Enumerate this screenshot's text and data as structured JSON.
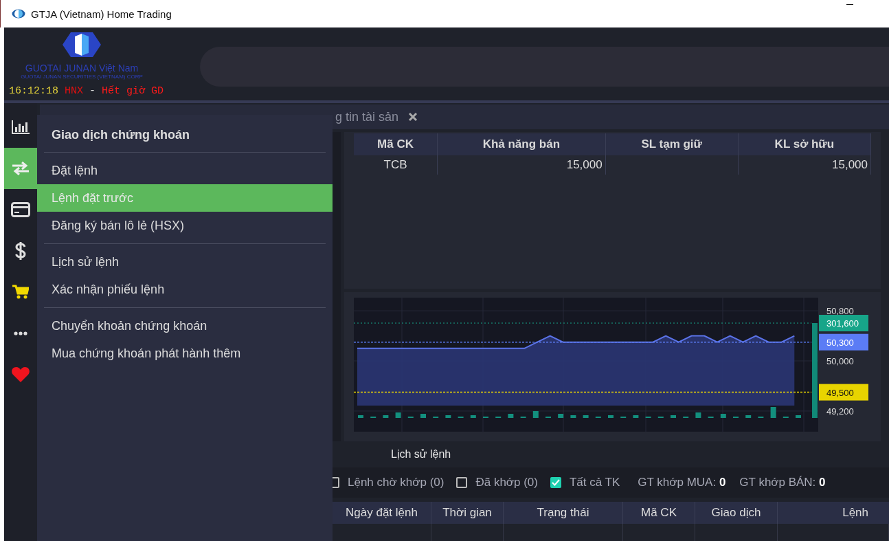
{
  "window": {
    "title": "GTJA (Vietnam) Home Trading"
  },
  "brand": {
    "name": "GUOTAI JUNAN Việt Nam",
    "subtitle": "GUOTAI JUNAN SECURITIES (VIETNAM) CORP"
  },
  "clock": {
    "time": "16:12:18",
    "exchange": "HNX",
    "separator": "-",
    "status": "Hết giờ GD"
  },
  "sidebar": {
    "items": [
      {
        "kind": "chart",
        "selected": false
      },
      {
        "kind": "transfer",
        "selected": true
      },
      {
        "kind": "card",
        "selected": false
      },
      {
        "kind": "dollar",
        "selected": false
      },
      {
        "kind": "cart",
        "selected": false
      },
      {
        "kind": "more",
        "selected": false
      },
      {
        "kind": "heart",
        "selected": false
      }
    ]
  },
  "tabs": [
    {
      "label": "g tin tài sản",
      "selected": false
    }
  ],
  "menu": {
    "title": "Giao dịch chứng khoán",
    "groups": [
      {
        "items": [
          {
            "label": "Đặt lệnh",
            "selected": false
          },
          {
            "label": "Lệnh đặt trước",
            "selected": true
          },
          {
            "label": "Đăng ký bán lô lẻ (HSX)",
            "selected": false
          }
        ]
      },
      {
        "items": [
          {
            "label": "Lịch sử lệnh",
            "selected": false
          },
          {
            "label": "Xác nhận phiếu lệnh",
            "selected": false
          }
        ]
      },
      {
        "items": [
          {
            "label": "Chuyển khoản chứng khoán",
            "selected": false
          },
          {
            "label": "Mua chứng khoán phát hành thêm",
            "selected": false
          }
        ]
      }
    ]
  },
  "holdings": {
    "columns": [
      "Mã CK",
      "Khả năng bán",
      "SL tạm giữ",
      "KL sở hữu"
    ],
    "rows": [
      {
        "cells": [
          "TCB",
          "15,000",
          null,
          "15,000"
        ]
      }
    ]
  },
  "chart": {
    "volume_label": "301,600",
    "chart_data": {
      "type": "area",
      "grid": true,
      "ylim": [
        48870,
        51010
      ],
      "yticks": [
        {
          "value": 49200,
          "label": "49,200"
        },
        {
          "value": 50000,
          "label": "50,000"
        },
        {
          "value": 50800,
          "label": "50,800"
        }
      ],
      "series": [
        {
          "color": "#5b73e8",
          "values": [
            50200,
            50200,
            50200,
            50200,
            50200,
            50200,
            50200,
            50200,
            50200,
            50200,
            50200,
            50200,
            50200,
            50200,
            50300,
            50400,
            50300,
            50300,
            50300,
            50300,
            50300,
            50300,
            50300,
            50300,
            50400,
            50300,
            50400,
            50400,
            50300,
            50400,
            50300,
            50400,
            50300,
            50300,
            50400,
            null
          ]
        }
      ],
      "ref_lines": [
        {
          "axis": "y",
          "value": 50300,
          "label": "50,300",
          "color": "#5b7cf5"
        },
        {
          "axis": "y",
          "value": 49500,
          "label": "49,500",
          "color": "#e8d400"
        }
      ]
    }
  },
  "history": {
    "tab": "Lịch sử lệnh",
    "filters": [
      {
        "label": "Lệnh chờ khớp (0)",
        "checked": false
      },
      {
        "label": "Đã khớp (0)",
        "checked": false
      },
      {
        "label": "Tất cả TK",
        "checked": true
      }
    ],
    "totals": [
      {
        "label": "GT khớp MUA:",
        "value": "0"
      },
      {
        "label": "GT khớp BÁN:",
        "value": "0"
      }
    ],
    "columns": [
      "Ngày đặt lệnh",
      "Thời gian",
      "Trạng thái",
      "Mã CK",
      "Giao dịch",
      "Lệnh"
    ]
  }
}
